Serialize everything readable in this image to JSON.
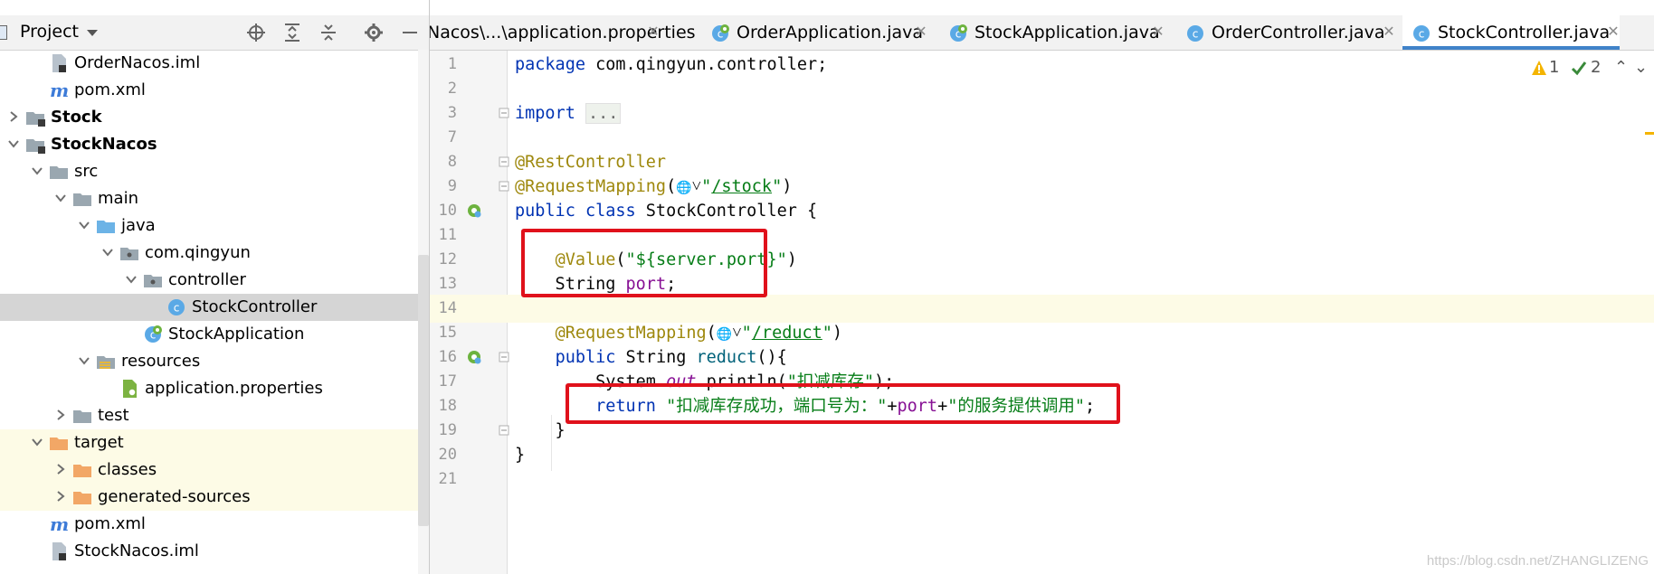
{
  "project_panel": {
    "title": "Project",
    "tree": [
      {
        "label": "OrderNacos.iml",
        "icon": "iml-file-icon",
        "depth": 2,
        "arrow": "none",
        "bold": false,
        "band": false,
        "selected": false
      },
      {
        "label": "pom.xml",
        "icon": "maven-icon",
        "depth": 2,
        "arrow": "none",
        "bold": false,
        "band": false,
        "selected": false
      },
      {
        "label": "Stock",
        "icon": "module-folder-icon",
        "depth": 1,
        "arrow": "right",
        "bold": true,
        "band": false,
        "selected": false
      },
      {
        "label": "StockNacos",
        "icon": "module-folder-icon",
        "depth": 1,
        "arrow": "down",
        "bold": true,
        "band": false,
        "selected": false
      },
      {
        "label": "src",
        "icon": "folder-icon",
        "depth": 2,
        "arrow": "down",
        "bold": false,
        "band": false,
        "selected": false
      },
      {
        "label": "main",
        "icon": "folder-icon",
        "depth": 3,
        "arrow": "down",
        "bold": false,
        "band": false,
        "selected": false
      },
      {
        "label": "java",
        "icon": "source-folder-icon",
        "depth": 4,
        "arrow": "down",
        "bold": false,
        "band": false,
        "selected": false
      },
      {
        "label": "com.qingyun",
        "icon": "package-icon",
        "depth": 5,
        "arrow": "down",
        "bold": false,
        "band": false,
        "selected": false
      },
      {
        "label": "controller",
        "icon": "package-icon",
        "depth": 6,
        "arrow": "down",
        "bold": false,
        "band": false,
        "selected": false
      },
      {
        "label": "StockController",
        "icon": "class-icon",
        "depth": 7,
        "arrow": "none",
        "bold": false,
        "band": false,
        "selected": true
      },
      {
        "label": "StockApplication",
        "icon": "spring-class-icon",
        "depth": 6,
        "arrow": "none",
        "bold": false,
        "band": false,
        "selected": false
      },
      {
        "label": "resources",
        "icon": "resources-folder-icon",
        "depth": 4,
        "arrow": "down",
        "bold": false,
        "band": false,
        "selected": false
      },
      {
        "label": "application.properties",
        "icon": "properties-icon",
        "depth": 5,
        "arrow": "none",
        "bold": false,
        "band": false,
        "selected": false
      },
      {
        "label": "test",
        "icon": "folder-icon",
        "depth": 3,
        "arrow": "right",
        "bold": false,
        "band": false,
        "selected": false
      },
      {
        "label": "target",
        "icon": "excluded-folder-icon",
        "depth": 2,
        "arrow": "down",
        "bold": false,
        "band": true,
        "selected": false
      },
      {
        "label": "classes",
        "icon": "excluded-folder-icon",
        "depth": 3,
        "arrow": "right",
        "bold": false,
        "band": true,
        "selected": false
      },
      {
        "label": "generated-sources",
        "icon": "excluded-folder-icon",
        "depth": 3,
        "arrow": "right",
        "bold": false,
        "band": true,
        "selected": false
      },
      {
        "label": "pom.xml",
        "icon": "maven-icon",
        "depth": 2,
        "arrow": "none",
        "bold": false,
        "band": false,
        "selected": false
      },
      {
        "label": "StockNacos.iml",
        "icon": "iml-file-icon",
        "depth": 2,
        "arrow": "none",
        "bold": false,
        "band": false,
        "selected": false
      }
    ]
  },
  "tabs": [
    {
      "label": "Nacos\\...\\application.properties",
      "icon": "",
      "active": false
    },
    {
      "label": "OrderApplication.java",
      "icon": "spring-class-icon",
      "active": false
    },
    {
      "label": "StockApplication.java",
      "icon": "spring-class-icon",
      "active": false
    },
    {
      "label": "OrderController.java",
      "icon": "class-icon",
      "active": false
    },
    {
      "label": "StockController.java",
      "icon": "class-icon",
      "active": true
    }
  ],
  "inspections": {
    "warnings": "1",
    "weak_warnings": "2"
  },
  "editor": {
    "lines": [
      {
        "n": "1",
        "segs": [
          [
            "kw",
            "package"
          ],
          [
            "txt",
            " com.qingyun.controller;"
          ]
        ]
      },
      {
        "n": "2",
        "segs": []
      },
      {
        "n": "3",
        "fold": true,
        "segs": [
          [
            "kw",
            "import"
          ],
          [
            "txt",
            " "
          ],
          [
            "dots",
            "..."
          ]
        ]
      },
      {
        "n": "7",
        "segs": []
      },
      {
        "n": "8",
        "fold": true,
        "segs": [
          [
            "ann",
            "@RestController"
          ]
        ]
      },
      {
        "n": "9",
        "fold": true,
        "segs": [
          [
            "ann",
            "@RequestMapping"
          ],
          [
            "txt",
            "("
          ],
          [
            "globe",
            ""
          ],
          [
            "txt",
            "˅"
          ],
          [
            "str",
            "\""
          ],
          [
            "url",
            "/stock"
          ],
          [
            "str",
            "\""
          ],
          [
            "txt",
            ")"
          ]
        ]
      },
      {
        "n": "10",
        "bean": true,
        "segs": [
          [
            "kw",
            "public class"
          ],
          [
            "txt",
            " StockController {"
          ]
        ]
      },
      {
        "n": "11",
        "segs": []
      },
      {
        "n": "12",
        "segs": [
          [
            "txt",
            "    "
          ],
          [
            "ann",
            "@Value"
          ],
          [
            "txt",
            "("
          ],
          [
            "str",
            "\"${server.port}\""
          ],
          [
            "txt",
            ")"
          ]
        ]
      },
      {
        "n": "13",
        "segs": [
          [
            "txt",
            "    String "
          ],
          [
            "fld",
            "port"
          ],
          [
            "txt",
            ";"
          ]
        ]
      },
      {
        "n": "14",
        "cur": true,
        "segs": []
      },
      {
        "n": "15",
        "segs": [
          [
            "txt",
            "    "
          ],
          [
            "ann",
            "@RequestMapping"
          ],
          [
            "txt",
            "("
          ],
          [
            "globe",
            ""
          ],
          [
            "txt",
            "˅"
          ],
          [
            "str",
            "\""
          ],
          [
            "url",
            "/reduct"
          ],
          [
            "str",
            "\""
          ],
          [
            "txt",
            ")"
          ]
        ]
      },
      {
        "n": "16",
        "bean": true,
        "fold": true,
        "segs": [
          [
            "txt",
            "    "
          ],
          [
            "kw",
            "public"
          ],
          [
            "txt",
            " String "
          ],
          [
            "fn",
            "reduct"
          ],
          [
            "txt",
            "(){"
          ]
        ]
      },
      {
        "n": "17",
        "segs": [
          [
            "txt",
            "        System."
          ],
          [
            "sfld",
            "out"
          ],
          [
            "txt",
            ".println("
          ],
          [
            "str",
            "\"扣减库存\""
          ],
          [
            "txt",
            ");"
          ]
        ]
      },
      {
        "n": "18",
        "segs": [
          [
            "txt",
            "        "
          ],
          [
            "kw",
            "return"
          ],
          [
            "txt",
            " "
          ],
          [
            "str",
            "\"扣减库存成功，端口号为：\""
          ],
          [
            "txt",
            "+"
          ],
          [
            "fld",
            "port"
          ],
          [
            "txt",
            "+"
          ],
          [
            "str",
            "\"的服务提供调用\""
          ],
          [
            "txt",
            ";"
          ]
        ]
      },
      {
        "n": "19",
        "fold": true,
        "segs": [
          [
            "txt",
            "    }"
          ]
        ]
      },
      {
        "n": "20",
        "segs": [
          [
            "txt",
            "}"
          ]
        ]
      },
      {
        "n": "21",
        "segs": []
      }
    ]
  },
  "watermark": "https://blog.csdn.net/ZHANGLIZENG",
  "colors": {
    "highlight_box": "#e0111b",
    "active_tab_underline": "#4083c9",
    "current_line": "#fdfbe6"
  }
}
